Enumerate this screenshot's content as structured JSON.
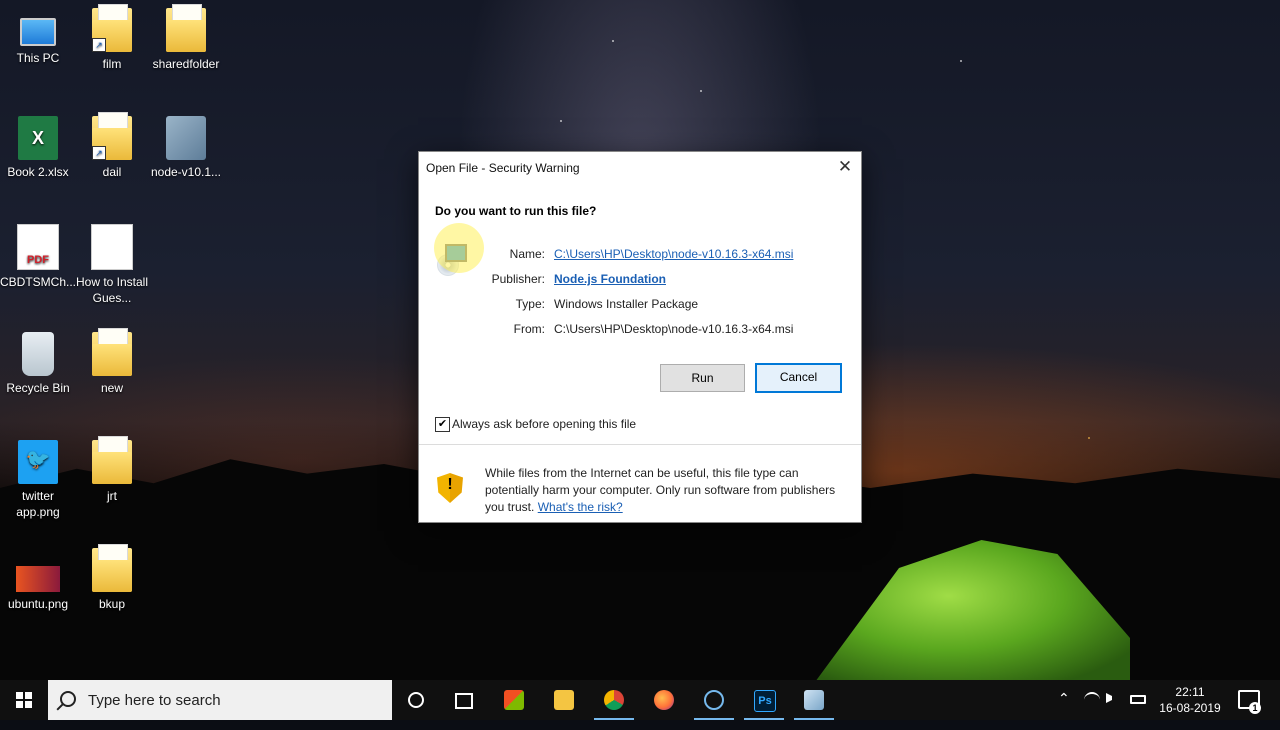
{
  "desktop": {
    "icons": [
      {
        "label": "This PC"
      },
      {
        "label": "film"
      },
      {
        "label": "sharedfolder"
      },
      {
        "label": "Book 2.xlsx"
      },
      {
        "label": "dail"
      },
      {
        "label": "node-v10.1..."
      },
      {
        "label": "CBDTSMCh..."
      },
      {
        "label": "How to Install Gues..."
      },
      {
        "label": "Recycle Bin"
      },
      {
        "label": "new"
      },
      {
        "label": "twitter app.png"
      },
      {
        "label": "jrt"
      },
      {
        "label": "ubuntu.png"
      },
      {
        "label": "bkup"
      }
    ]
  },
  "dialog": {
    "title": "Open File - Security Warning",
    "close_glyph": "✕",
    "question": "Do you want to run this file?",
    "fields": {
      "name_label": "Name:",
      "name_value": "C:\\Users\\HP\\Desktop\\node-v10.16.3-x64.msi",
      "publisher_label": "Publisher:",
      "publisher_value": "Node.js Foundation",
      "type_label": "Type:",
      "type_value": "Windows Installer Package",
      "from_label": "From:",
      "from_value": "C:\\Users\\HP\\Desktop\\node-v10.16.3-x64.msi"
    },
    "run_label": "Run",
    "cancel_label": "Cancel",
    "always_ask_checked": true,
    "always_ask_check_glyph": "✔",
    "always_ask_label": "Always ask before opening this file",
    "warning_text": "While files from the Internet can be useful, this file type can potentially harm your computer. Only run software from publishers you trust.",
    "risk_link": "What's the risk?",
    "shield_mark": "!"
  },
  "taskbar": {
    "search_placeholder": "Type here to search",
    "ps_label": "Ps",
    "clock_time": "22:11",
    "clock_date": "16-08-2019",
    "notification_count": "1",
    "tray_up_glyph": "⌃"
  },
  "colors": {
    "accent": "#0078d7",
    "link": "#1a5fb4",
    "taskbar_bg": "#101010"
  }
}
